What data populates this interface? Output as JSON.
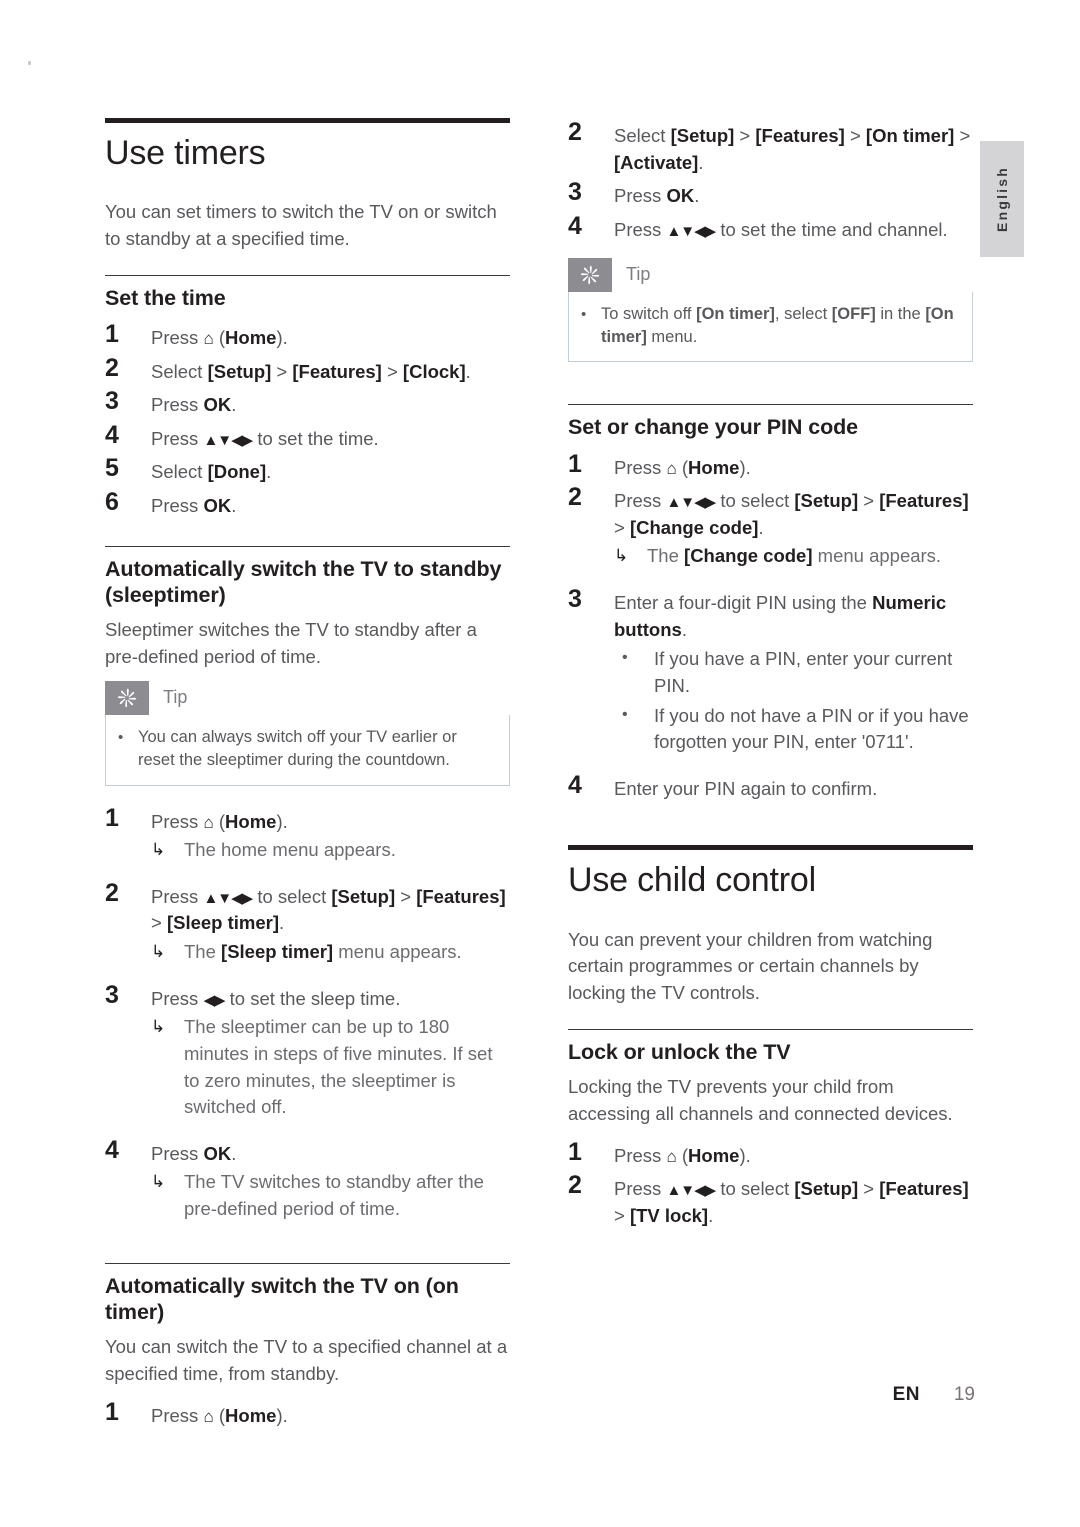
{
  "language_tab": "English",
  "footer": {
    "locale": "EN",
    "page_number": "19"
  },
  "icons": {
    "home": "home-icon",
    "tip": "tip-asterisk-icon",
    "result_arrow": "↳",
    "nav_all": "▲▼◀▶",
    "nav_lr": "◀▶",
    "bullet": "•"
  },
  "left_column": {
    "chapter": {
      "title": "Use timers",
      "intro": "You can set timers to switch the TV on or switch to standby at a specified time."
    },
    "sections": [
      {
        "heading": "Set the time",
        "steps": [
          {
            "num": "1",
            "text_before": "Press ",
            "icon": "home-icon",
            "text_after": " (Home)."
          },
          {
            "num": "2",
            "text": "Select [Setup] > [Features] > [Clock]."
          },
          {
            "num": "3",
            "text": "Press OK."
          },
          {
            "num": "4",
            "text": "Press ▲▼◀▶ to set the time."
          },
          {
            "num": "5",
            "text": "Select [Done]."
          },
          {
            "num": "6",
            "text": "Press OK."
          }
        ]
      },
      {
        "heading": "Automatically switch the TV to standby (sleeptimer)",
        "intro": "Sleeptimer switches the TV to standby after a pre-defined period of time.",
        "tip": {
          "label": "Tip",
          "items": [
            "You can always switch off your TV earlier or reset the sleeptimer during the countdown."
          ]
        },
        "steps": [
          {
            "num": "1",
            "text_before": "Press ",
            "icon": "home-icon",
            "text_after": " (Home).",
            "result": "The home menu appears."
          },
          {
            "num": "2",
            "text": "Press ▲▼◀▶ to select [Setup] > [Features] > [Sleep timer].",
            "result": "The [Sleep timer] menu appears."
          },
          {
            "num": "3",
            "text": "Press ◀▶ to set the sleep time.",
            "result": "The sleeptimer can be up to 180 minutes in steps of five minutes. If set to zero minutes, the sleeptimer is switched off."
          },
          {
            "num": "4",
            "text": "Press OK.",
            "result": "The TV switches to standby after the pre-defined period of time."
          }
        ]
      },
      {
        "heading": "Automatically switch the TV on (on timer)",
        "intro": "You can switch the TV to a specified channel at a specified time, from standby.",
        "steps": [
          {
            "num": "1",
            "text_before": "Press ",
            "icon": "home-icon",
            "text_after": " (Home)."
          }
        ]
      }
    ]
  },
  "right_column": {
    "continued_steps": [
      {
        "num": "2",
        "text": "Select [Setup] > [Features] > [On timer] > [Activate]."
      },
      {
        "num": "3",
        "text": "Press OK."
      },
      {
        "num": "4",
        "text": "Press ▲▼◀▶ to set the time and channel."
      }
    ],
    "tip": {
      "label": "Tip",
      "items": [
        "To switch off [On timer], select [OFF] in the [On timer] menu."
      ]
    },
    "pin_section": {
      "heading": "Set or change your PIN code",
      "steps": [
        {
          "num": "1",
          "text_before": "Press ",
          "icon": "home-icon",
          "text_after": " (Home)."
        },
        {
          "num": "2",
          "text": "Press ▲▼◀▶ to select [Setup] > [Features] > [Change code].",
          "result": "The [Change code] menu appears."
        },
        {
          "num": "3",
          "text": "Enter a four-digit PIN using the Numeric buttons.",
          "bullets": [
            "If you have a PIN, enter your current PIN.",
            "If you do not have a PIN or if you have forgotten your PIN, enter '0711'."
          ]
        },
        {
          "num": "4",
          "text": "Enter your PIN again to confirm."
        }
      ]
    },
    "child_control": {
      "title": "Use child control",
      "intro": "You can prevent your children from watching certain programmes or certain channels by locking the TV controls.",
      "section": {
        "heading": "Lock or unlock the TV",
        "intro": "Locking the TV prevents your child from accessing all channels and connected devices.",
        "steps": [
          {
            "num": "1",
            "text_before": "Press ",
            "icon": "home-icon",
            "text_after": " (Home)."
          },
          {
            "num": "2",
            "text": "Press ▲▼◀▶ to select [Setup] > [Features] > [TV lock]."
          }
        ]
      }
    }
  }
}
